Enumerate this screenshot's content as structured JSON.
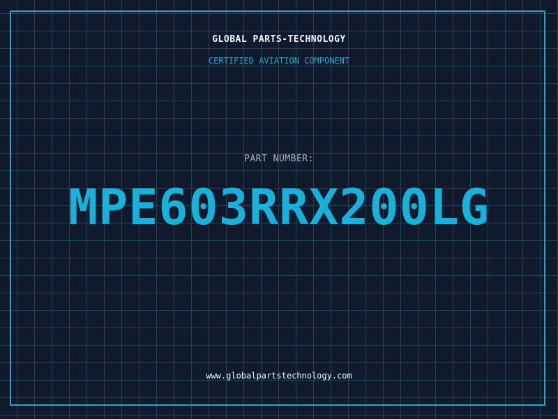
{
  "header": {
    "company": "GLOBAL PARTS-TECHNOLOGY",
    "subtitle": "CERTIFIED AVIATION COMPONENT"
  },
  "main": {
    "part_label": "PART NUMBER:",
    "part_number": "MPE603RRX200LG"
  },
  "footer": {
    "website": "www.globalpartstechnology.com"
  },
  "colors": {
    "background": "#111a2c",
    "grid": "#21445a",
    "accent": "#23a7c9",
    "part_number": "#17b1d9",
    "text": "#f2f5f8",
    "muted_text": "#aab4c0"
  }
}
